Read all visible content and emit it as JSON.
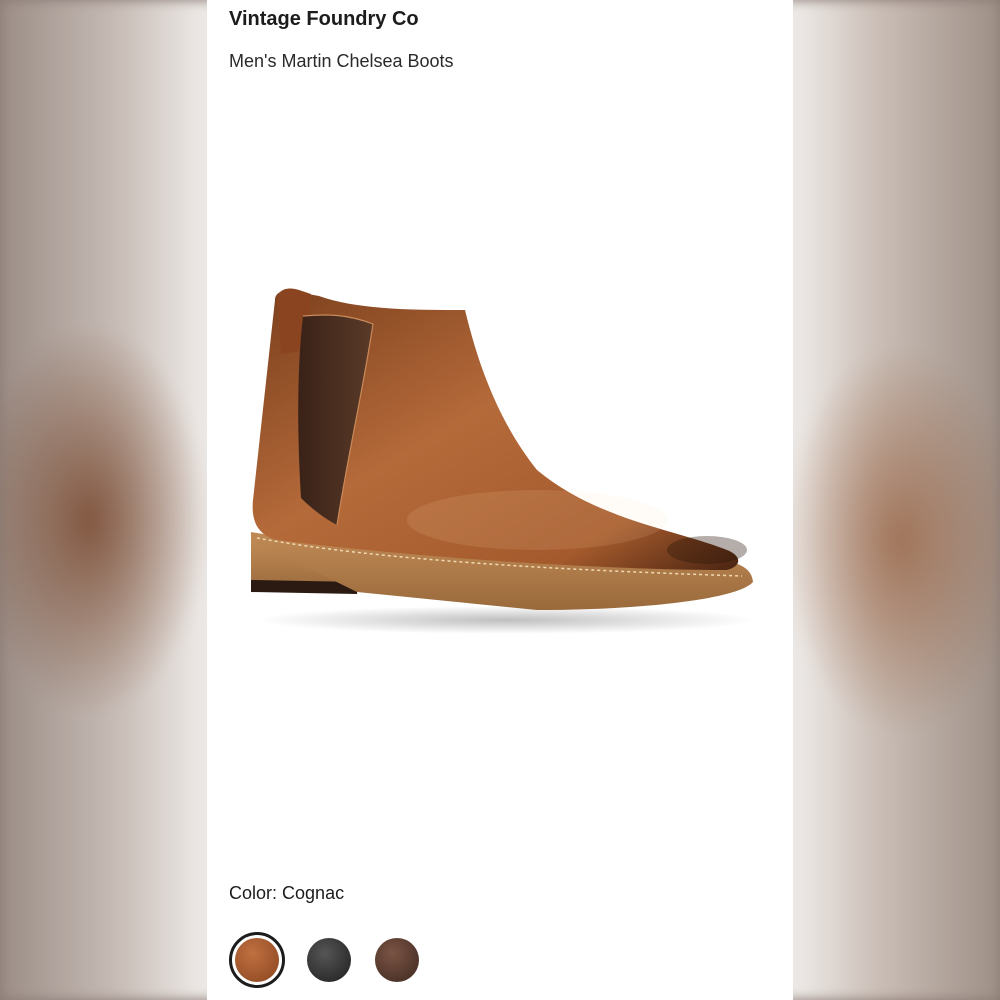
{
  "product": {
    "brand": "Vintage Foundry Co",
    "name": "Men's Martin Chelsea Boots"
  },
  "color": {
    "label": "Color:",
    "selected": "Cognac",
    "swatches": [
      {
        "name": "cognac-swatch",
        "color": "#a0582f",
        "selected": true
      },
      {
        "name": "black-swatch",
        "color": "#2e2e2e",
        "selected": false
      },
      {
        "name": "brown-swatch",
        "color": "#5a3a2e",
        "selected": false
      }
    ]
  }
}
